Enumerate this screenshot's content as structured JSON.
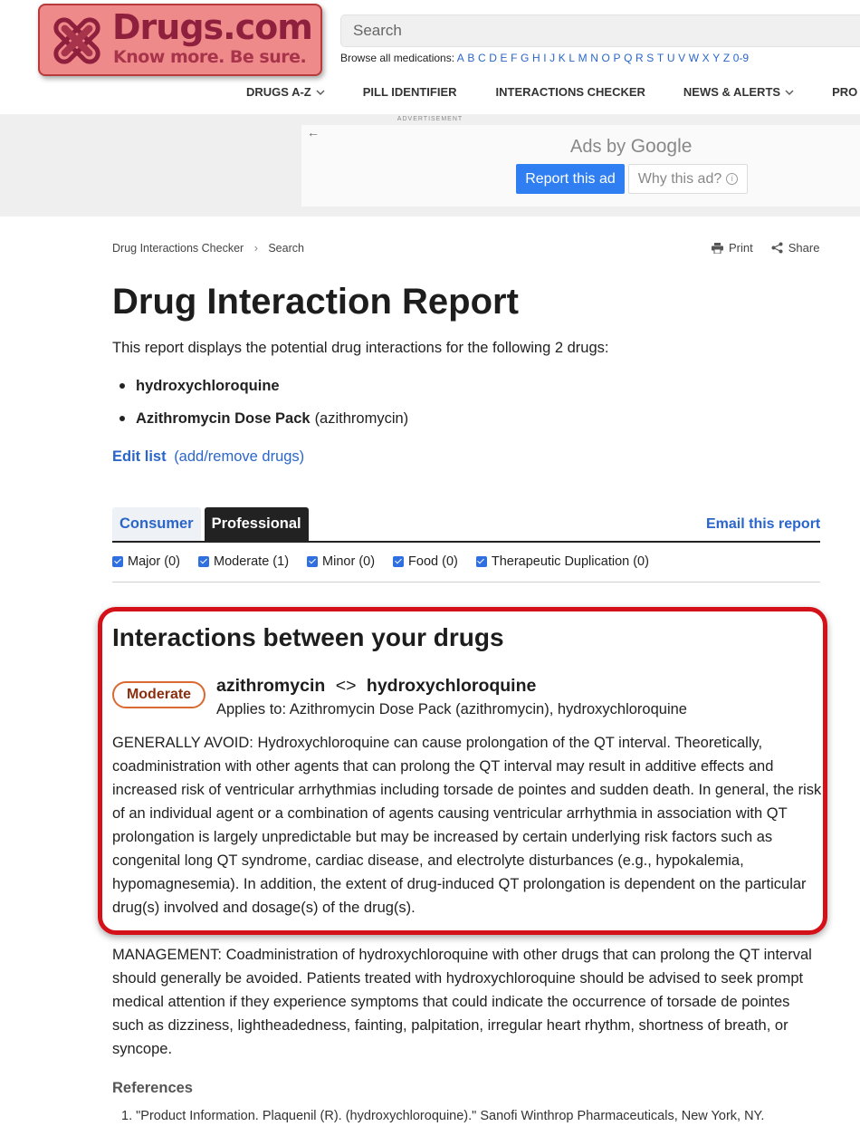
{
  "header": {
    "logo_name": "Drugs.com",
    "logo_tagline": "Know more. Be sure.",
    "search_placeholder": "Search",
    "browse_label": "Browse all medications:",
    "browse_letters": [
      "A",
      "B",
      "C",
      "D",
      "E",
      "F",
      "G",
      "H",
      "I",
      "J",
      "K",
      "L",
      "M",
      "N",
      "O",
      "P",
      "Q",
      "R",
      "S",
      "T",
      "U",
      "V",
      "W",
      "X",
      "Y",
      "Z",
      "0-9"
    ],
    "nav": {
      "drugs_az": "DRUGS A-Z",
      "pill_identifier": "PILL IDENTIFIER",
      "interactions_checker": "INTERACTIONS CHECKER",
      "news_alerts": "NEWS & ALERTS",
      "pro": "PRO"
    }
  },
  "ad": {
    "label": "ADVERTISEMENT",
    "ads_by": "Ads by",
    "google": "Google",
    "report_button": "Report this ad",
    "why_button": "Why this ad?"
  },
  "breadcrumb": {
    "item1": "Drug Interactions Checker",
    "item2": "Search"
  },
  "tools": {
    "print": "Print",
    "share": "Share"
  },
  "report": {
    "title": "Drug Interaction Report",
    "intro": "This report displays the potential drug interactions for the following 2 drugs:",
    "drug1": "hydroxychloroquine",
    "drug2_brand": "Azithromycin Dose Pack",
    "drug2_generic": "(azithromycin)",
    "edit_list": "Edit list",
    "edit_list_note": "(add/remove drugs)"
  },
  "tabs": {
    "consumer": "Consumer",
    "professional": "Professional",
    "email": "Email this report"
  },
  "filters": {
    "major": "Major (0)",
    "moderate": "Moderate (1)",
    "minor": "Minor (0)",
    "food": "Food (0)",
    "duplication": "Therapeutic Duplication (0)"
  },
  "interaction": {
    "heading": "Interactions between your drugs",
    "severity": "Moderate",
    "drug_a": "azithromycin",
    "arrows": "<>",
    "drug_b": "hydroxychloroquine",
    "applies_to": "Applies to: Azithromycin Dose Pack (azithromycin), hydroxychloroquine",
    "description": "GENERALLY AVOID: Hydroxychloroquine can cause prolongation of the QT interval. Theoretically, coadministration with other agents that can prolong the QT interval may result in additive effects and increased risk of ventricular arrhythmias including torsade de pointes and sudden death. In general, the risk of an individual agent or a combination of agents causing ventricular arrhythmia in association with QT prolongation is largely unpredictable but may be increased by certain underlying risk factors such as congenital long QT syndrome, cardiac disease, and electrolyte disturbances (e.g., hypokalemia, hypomagnesemia). In addition, the extent of drug-induced QT prolongation is dependent on the particular drug(s) involved and dosage(s) of the drug(s).",
    "management": "MANAGEMENT: Coadministration of hydroxychloroquine with other drugs that can prolong the QT interval should generally be avoided. Patients treated with hydroxychloroquine should be advised to seek prompt medical attention if they experience symptoms that could indicate the occurrence of torsade de pointes such as dizziness, lightheadedness, fainting, palpitation, irregular heart rhythm, shortness of breath, or syncope."
  },
  "references": {
    "heading": "References",
    "item1": "1. \"Product Information. Plaquenil (R). (hydroxychloroquine).\" Sanofi Winthrop Pharmaceuticals, New York, NY."
  },
  "colors": {
    "link": "#2a66c9",
    "highlight_border": "#d41118",
    "moderate_badge": "#d96b32",
    "logo_bg": "#ef8a8a",
    "ad_button": "#2f7ff2"
  }
}
